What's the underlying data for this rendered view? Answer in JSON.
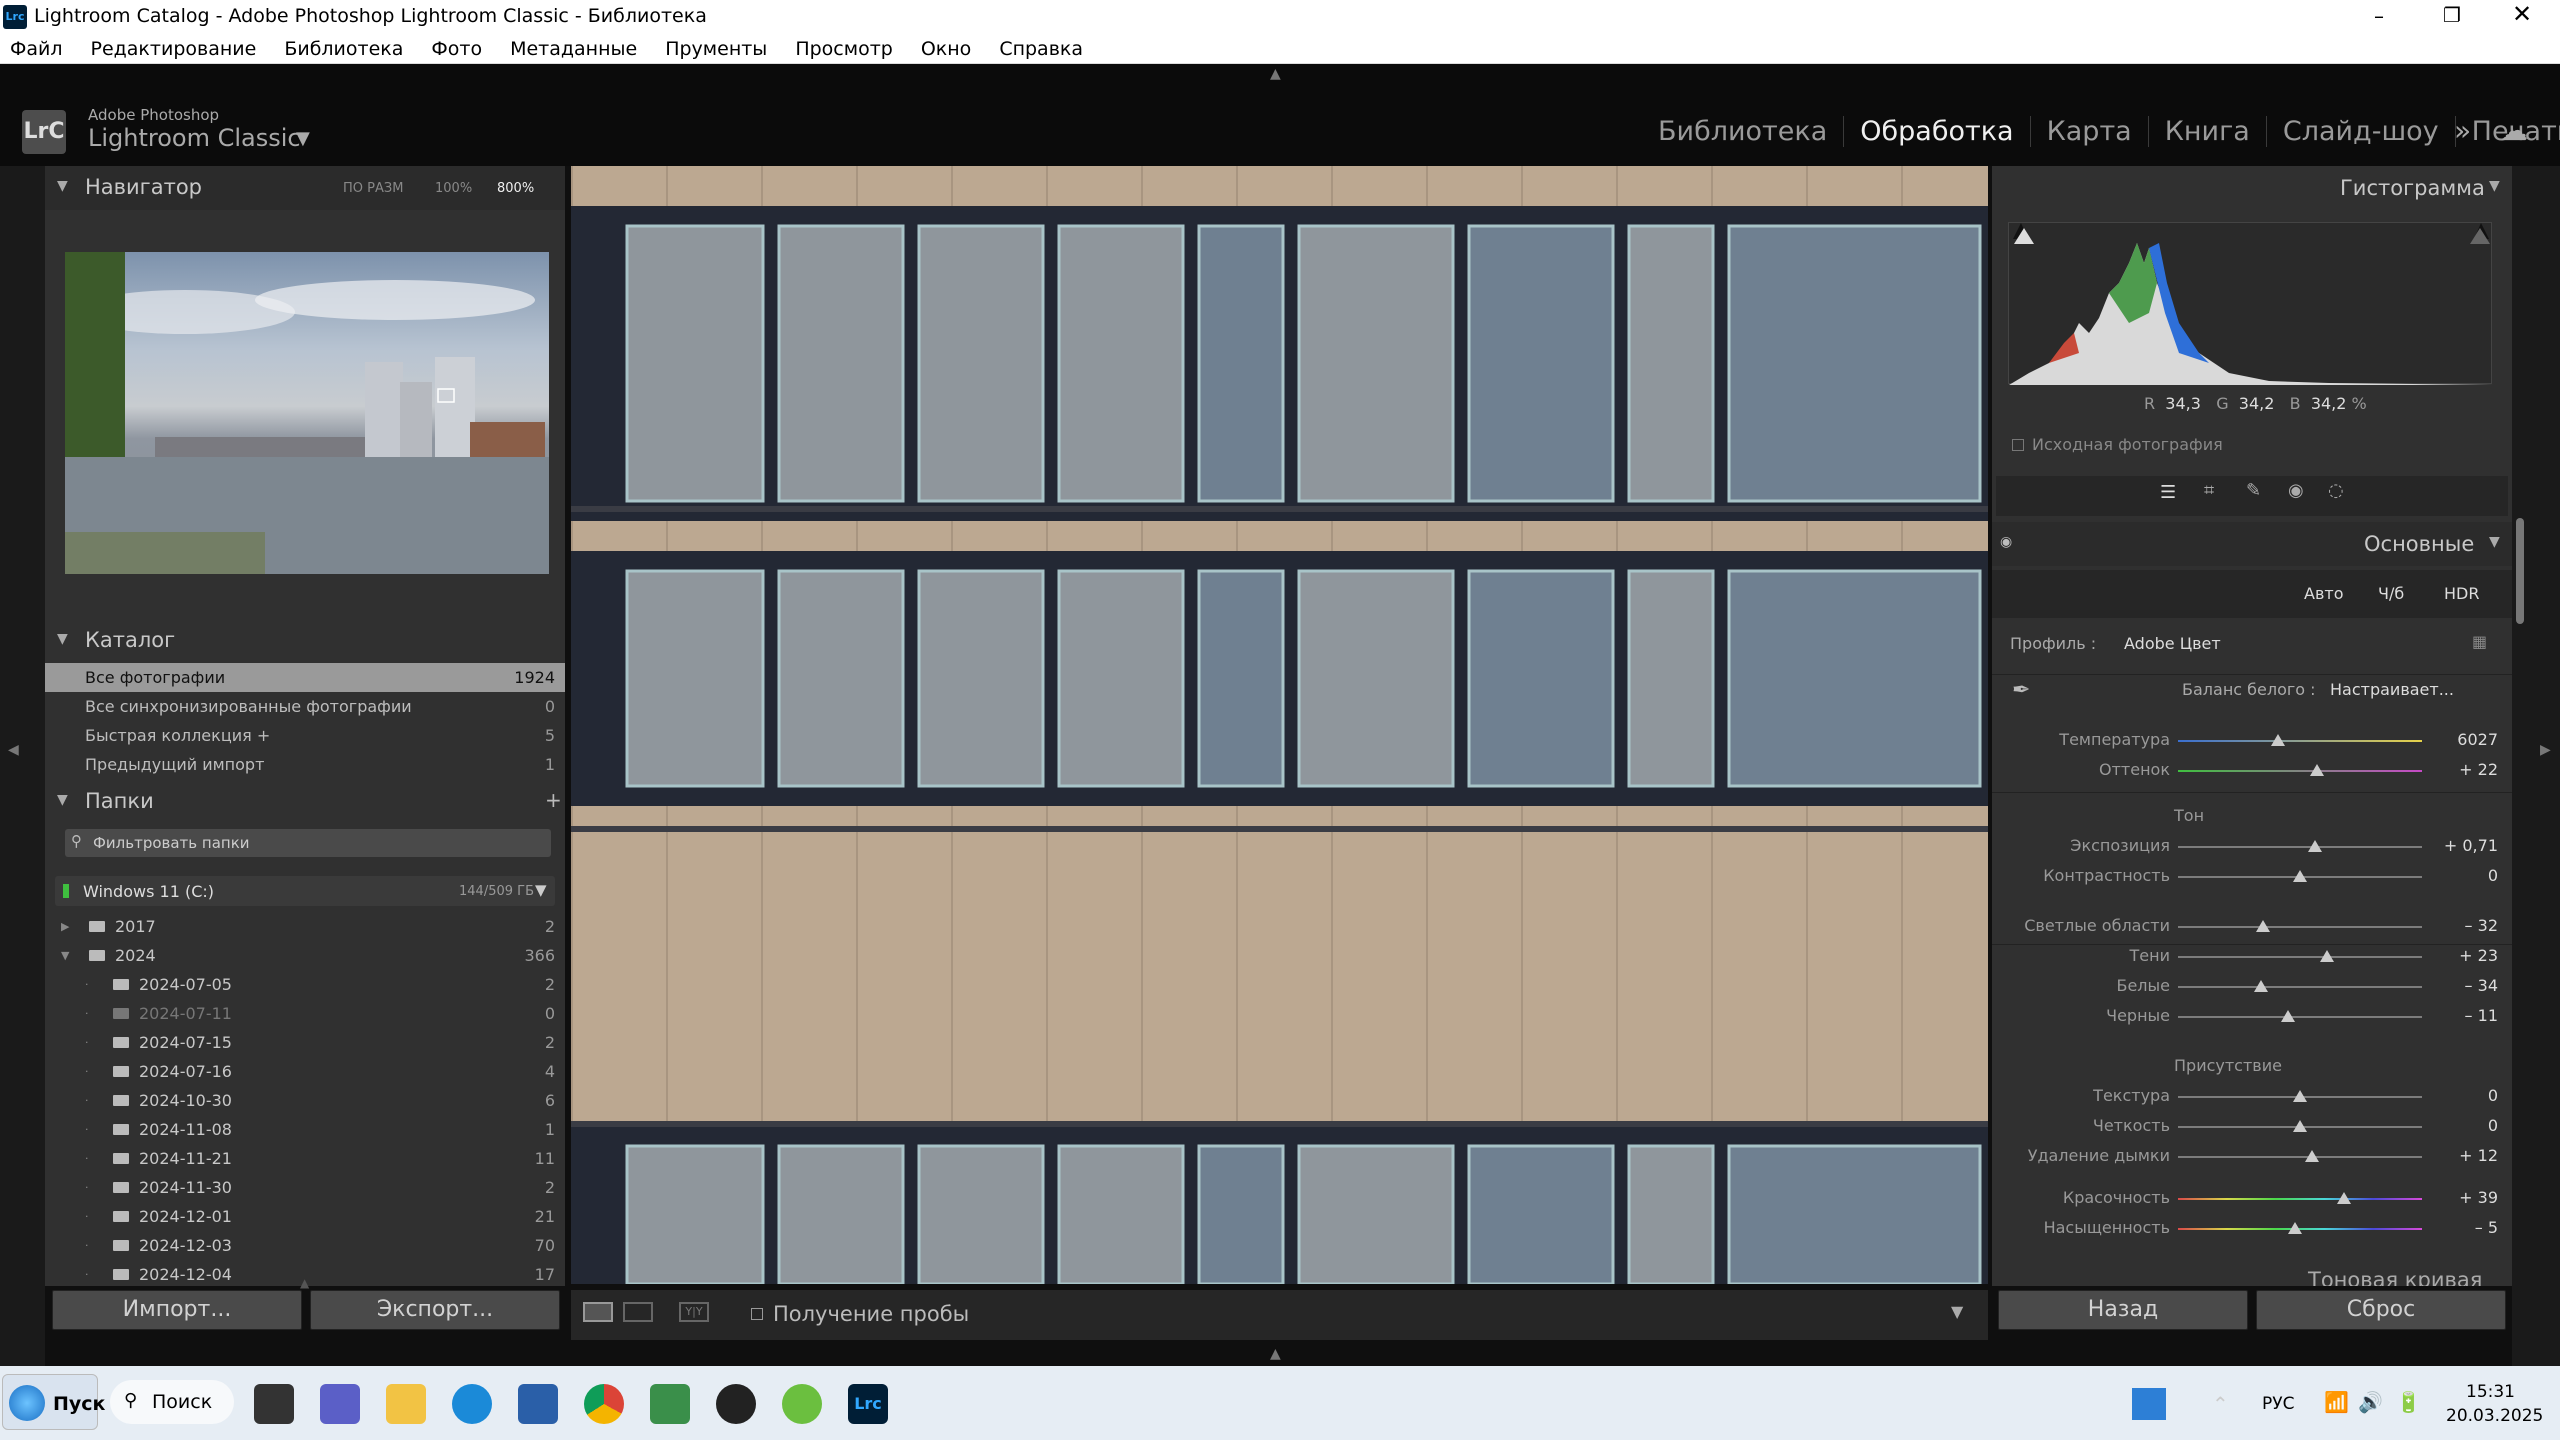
{
  "window": {
    "title": "Lightroom Catalog - Adobe Photoshop Lightroom Classic - Библиотека",
    "app_icon": "Lrc"
  },
  "menu": [
    "Файл",
    "Редактирование",
    "Библиотека",
    "Фото",
    "Метаданные",
    "Прументы",
    "Просмотр",
    "Окно",
    "Справка"
  ],
  "identity": {
    "line1": "Adobe Photoshop",
    "line2": "Lightroom Classic",
    "logo": "LrC"
  },
  "modules": [
    {
      "label": "Библиотека",
      "active": false
    },
    {
      "label": "Обработка",
      "active": true
    },
    {
      "label": "Карта",
      "active": false
    },
    {
      "label": "Книга",
      "active": false
    },
    {
      "label": "Слайд-шоу",
      "active": false
    },
    {
      "label": "Печать",
      "active": false
    }
  ],
  "navigator": {
    "title": "Навигатор",
    "zoom_fit": "ПО РАЗМ",
    "zoom_100": "100%",
    "zoom_800": "800%"
  },
  "catalog": {
    "title": "Каталог",
    "items": [
      {
        "label": "Все фотографии",
        "count": "1924",
        "selected": true
      },
      {
        "label": "Все синхронизированные фотографии",
        "count": "0",
        "selected": false
      },
      {
        "label": "Быстрая коллекция +",
        "count": "5",
        "selected": false
      },
      {
        "label": "Предыдущий импорт",
        "count": "1",
        "selected": false
      }
    ]
  },
  "folders": {
    "title": "Папки",
    "add": "+",
    "filter_placeholder": "Фильтровать папки",
    "volume": {
      "name": "Windows 11 (C:)",
      "size": "144/509 ГБ"
    },
    "items": [
      {
        "label": "2017",
        "count": "2",
        "level": 0,
        "dim": false
      },
      {
        "label": "2024",
        "count": "366",
        "level": 0,
        "dim": false
      },
      {
        "label": "2024-07-05",
        "count": "2",
        "level": 1,
        "dim": false
      },
      {
        "label": "2024-07-11",
        "count": "0",
        "level": 1,
        "dim": true
      },
      {
        "label": "2024-07-15",
        "count": "2",
        "level": 1,
        "dim": false
      },
      {
        "label": "2024-07-16",
        "count": "4",
        "level": 1,
        "dim": false
      },
      {
        "label": "2024-10-30",
        "count": "6",
        "level": 1,
        "dim": false
      },
      {
        "label": "2024-11-08",
        "count": "1",
        "level": 1,
        "dim": false
      },
      {
        "label": "2024-11-21",
        "count": "11",
        "level": 1,
        "dim": false
      },
      {
        "label": "2024-11-30",
        "count": "2",
        "level": 1,
        "dim": false
      },
      {
        "label": "2024-12-01",
        "count": "21",
        "level": 1,
        "dim": false
      },
      {
        "label": "2024-12-03",
        "count": "70",
        "level": 1,
        "dim": false
      },
      {
        "label": "2024-12-04",
        "count": "17",
        "level": 1,
        "dim": false
      }
    ]
  },
  "left_buttons": {
    "import": "Импорт...",
    "export": "Экспорт..."
  },
  "toolbar": {
    "sampler": "Получение пробы"
  },
  "histogram": {
    "title": "Гистограмма",
    "r_label": "R",
    "r": "34,3",
    "g_label": "G",
    "g": "34,2",
    "b_label": "B",
    "b": "34,2",
    "unit": "%",
    "original": "Исходная фотография"
  },
  "basic": {
    "title": "Основные",
    "auto": "Авто",
    "bw": "Ч/б",
    "hdr": "HDR",
    "profile_label": "Профиль :",
    "profile_value": "Adobe Цвет",
    "wb_label": "Баланс белого :",
    "wb_value": "Настраивает...",
    "tone_header": "Тон",
    "presence_header": "Присутствие",
    "sliders": [
      {
        "label": "Температура",
        "value": "6027",
        "pos": 0.41,
        "track": "temp"
      },
      {
        "label": "Оттенок",
        "value": "+ 22",
        "pos": 0.57,
        "track": "tint"
      },
      {
        "label": "Экспозиция",
        "value": "+ 0,71",
        "pos": 0.56,
        "track": "plain"
      },
      {
        "label": "Контрастность",
        "value": "0",
        "pos": 0.5,
        "track": "plain"
      },
      {
        "label": "Светлые области",
        "value": "– 32",
        "pos": 0.35,
        "track": "plain"
      },
      {
        "label": "Тени",
        "value": "+ 23",
        "pos": 0.61,
        "track": "plain"
      },
      {
        "label": "Белые",
        "value": "– 34",
        "pos": 0.34,
        "track": "plain"
      },
      {
        "label": "Черные",
        "value": "– 11",
        "pos": 0.45,
        "track": "plain"
      },
      {
        "label": "Текстура",
        "value": "0",
        "pos": 0.5,
        "track": "plain"
      },
      {
        "label": "Четкость",
        "value": "0",
        "pos": 0.5,
        "track": "plain"
      },
      {
        "label": "Удаление дымки",
        "value": "+ 12",
        "pos": 0.55,
        "track": "plain"
      },
      {
        "label": "Красочность",
        "value": "+ 39",
        "pos": 0.68,
        "track": "sat"
      },
      {
        "label": "Насыщенность",
        "value": "– 5",
        "pos": 0.48,
        "track": "sat"
      }
    ],
    "next_panel": "Тоновая кривая"
  },
  "right_buttons": {
    "back": "Назад",
    "reset": "Сброс"
  },
  "taskbar": {
    "start": "Пуск",
    "search": "Поиск",
    "lang": "РУС",
    "time": "15:31",
    "date": "20.03.2025"
  }
}
